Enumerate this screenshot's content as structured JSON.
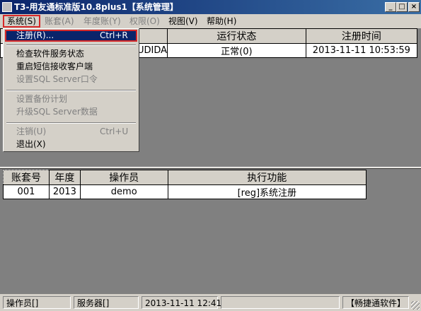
{
  "window": {
    "title": "T3-用友通标准版10.8plus1【系统管理】",
    "buttons": {
      "minimize": "_",
      "restore": "□",
      "close": "×"
    }
  },
  "menubar": [
    {
      "label": "系统(S)",
      "state": "active"
    },
    {
      "label": "账套(A)",
      "state": "disabled"
    },
    {
      "label": "年度账(Y)",
      "state": "disabled"
    },
    {
      "label": "权限(O)",
      "state": "disabled"
    },
    {
      "label": "视图(V)",
      "state": "enabled"
    },
    {
      "label": "帮助(H)",
      "state": "enabled"
    }
  ],
  "system_menu": {
    "register": {
      "label": "注册(R)...",
      "shortcut": "Ctrl+R"
    },
    "check_service": {
      "label": "检查软件服务状态"
    },
    "restart_sms": {
      "label": "重启短信接收客户端"
    },
    "set_sql_password": {
      "label": "设置SQL Server口令"
    },
    "backup_plan": {
      "label": "设置备份计划"
    },
    "upgrade_sql": {
      "label": "升级SQL Server数据"
    },
    "logout": {
      "label": "注销(U)",
      "shortcut": "Ctrl+U"
    },
    "exit": {
      "label": "退出(X)"
    }
  },
  "sites_table": {
    "headers": [
      "站点",
      "运行状态",
      "注册时间"
    ],
    "rows": [
      [
        "UDIDA",
        "正常(0)",
        "2013-11-11 10:53:59"
      ]
    ]
  },
  "tasks_table": {
    "headers": [
      "账套号",
      "年度",
      "操作员",
      "执行功能"
    ],
    "rows": [
      [
        "001",
        "2013",
        "demo",
        "[reg]系统注册"
      ]
    ]
  },
  "statusbar": {
    "operator": "操作员[]",
    "server": "服务器[]",
    "datetime": "2013-11-11 12:41",
    "brand": "【畅捷通软件】"
  }
}
